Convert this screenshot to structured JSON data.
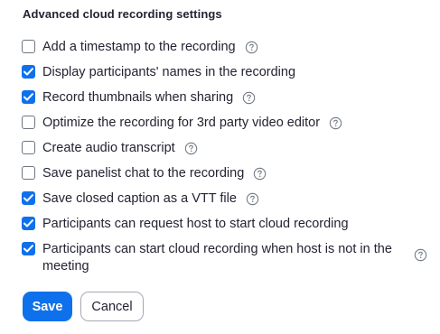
{
  "section": {
    "title": "Advanced cloud recording settings"
  },
  "options": [
    {
      "label": "Add a timestamp to the recording",
      "checked": false,
      "help_icon": "question-circle-icon"
    },
    {
      "label": "Display participants' names in the recording",
      "checked": true
    },
    {
      "label": "Record thumbnails when sharing",
      "checked": true,
      "help_icon": "question-circle-icon"
    },
    {
      "label": "Optimize the recording for 3rd party video editor",
      "checked": false,
      "help_icon": "question-circle-icon"
    },
    {
      "label": "Create audio transcript",
      "checked": false,
      "help_icon": "question-circle-icon"
    },
    {
      "label": "Save panelist chat to the recording",
      "checked": false,
      "help_icon": "question-circle-icon"
    },
    {
      "label": "Save closed caption as a VTT file",
      "checked": true,
      "help_icon": "question-circle-icon"
    },
    {
      "label": "Participants can request host to start cloud recording",
      "checked": true
    },
    {
      "label": "Participants can start cloud recording when host is not in the meeting",
      "checked": true,
      "help_icon": "question-circle-icon"
    }
  ],
  "actions": {
    "save_label": "Save",
    "cancel_label": "Cancel"
  },
  "colors": {
    "accent": "#0e71eb",
    "text": "#232333",
    "checkbox_border": "#6e7680"
  }
}
